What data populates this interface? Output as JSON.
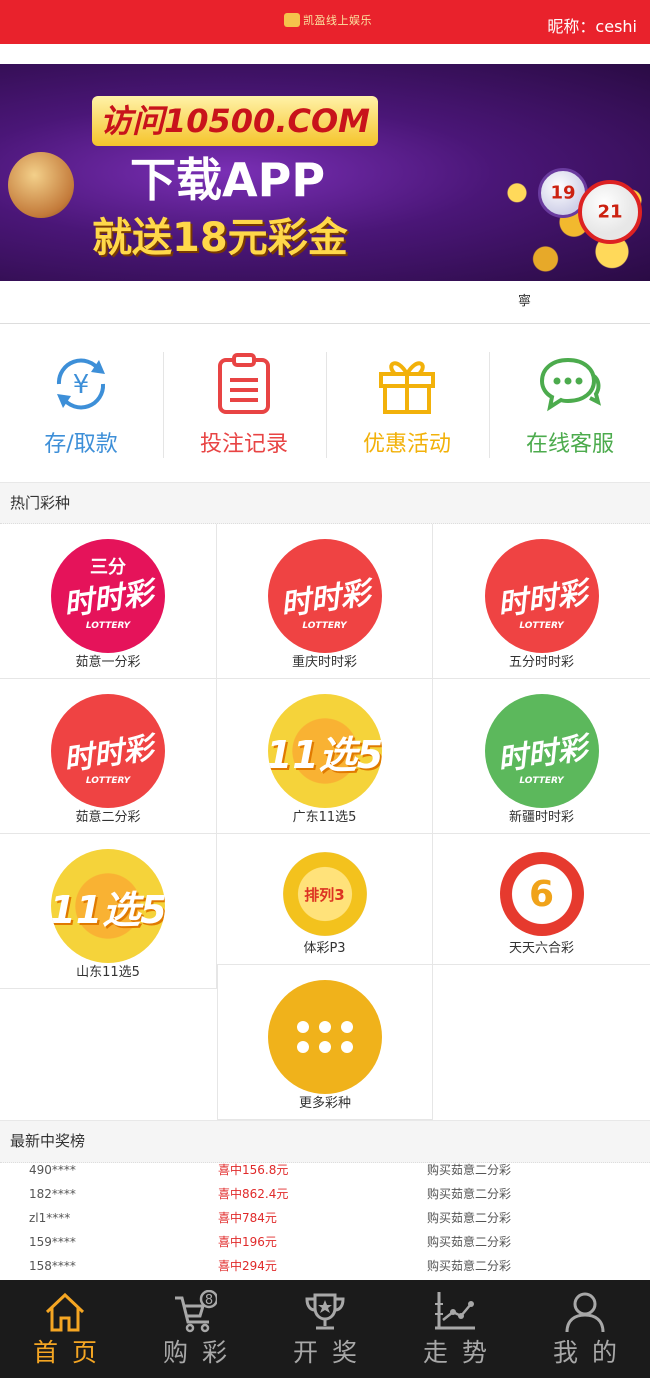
{
  "header": {
    "logo_text": "凯盈线上娱乐",
    "nickname": "昵称：ceshi",
    "bg_color": "#e9222c"
  },
  "banner": {
    "visit": "访问10500.COM",
    "line2": "下载APP",
    "line3": "就送18元彩金",
    "ball_a": "19",
    "ball_b": "21"
  },
  "notice": {
    "text": "寧"
  },
  "quick_actions": [
    {
      "label": "存/取款",
      "icon": "yen-exchange-icon",
      "color": "#3d8fd8"
    },
    {
      "label": "投注记录",
      "icon": "clipboard-icon",
      "color": "#e84444"
    },
    {
      "label": "优惠活动",
      "icon": "gift-icon",
      "color": "#f2b10a"
    },
    {
      "label": "在线客服",
      "icon": "chat-icon",
      "color": "#4cab4d"
    }
  ],
  "hot_section": {
    "title": "热门彩种"
  },
  "lotteries": [
    {
      "name": "茹意一分彩",
      "icon": "ssc-1min-icon",
      "top": "三分",
      "main": "时时彩",
      "sub": "LOTTERY",
      "color": "#e5135a"
    },
    {
      "name": "重庆时时彩",
      "icon": "ssc-icon",
      "main": "时时彩",
      "sub": "LOTTERY",
      "color": "#ef4343"
    },
    {
      "name": "五分时时彩",
      "icon": "ssc-icon",
      "main": "时时彩",
      "sub": "LOTTERY",
      "color": "#ef4343"
    },
    {
      "name": "茹意二分彩",
      "icon": "ssc-icon",
      "main": "时时彩",
      "sub": "LOTTERY",
      "color": "#ef4343"
    },
    {
      "name": "广东11选5",
      "icon": "11x5-icon",
      "main": "11选5",
      "color": "#f5d33a"
    },
    {
      "name": "新疆时时彩",
      "icon": "ssc-icon",
      "main": "时时彩",
      "sub": "LOTTERY",
      "color": "#5cb85c"
    },
    {
      "name": "山东11选5",
      "icon": "11x5-icon",
      "main": "11选5",
      "color": "#f5d33a"
    },
    {
      "name": "体彩P3",
      "icon": "p3-icon",
      "main": "排列3"
    },
    {
      "name": "天天六合彩",
      "icon": "liuhecai-icon",
      "main": "6"
    },
    {
      "name": "更多彩种",
      "icon": "more-dots-icon",
      "color": "#f0b21b"
    }
  ],
  "winners_section": {
    "title": "最新中奖榜"
  },
  "winners": [
    {
      "user": "490****",
      "amount": "喜中156.8元",
      "game": "购买茹意二分彩"
    },
    {
      "user": "182****",
      "amount": "喜中862.4元",
      "game": "购买茹意二分彩"
    },
    {
      "user": "zl1****",
      "amount": "喜中784元",
      "game": "购买茹意二分彩"
    },
    {
      "user": "159****",
      "amount": "喜中196元",
      "game": "购买茹意二分彩"
    },
    {
      "user": "158****",
      "amount": "喜中294元",
      "game": "购买茹意二分彩"
    }
  ],
  "tabbar": [
    {
      "label": "首页",
      "icon": "home-icon",
      "active": true
    },
    {
      "label": "购彩",
      "icon": "cart-icon",
      "badge": "8"
    },
    {
      "label": "开奖",
      "icon": "trophy-icon"
    },
    {
      "label": "走势",
      "icon": "trend-chart-icon"
    },
    {
      "label": "我的",
      "icon": "user-icon"
    }
  ],
  "colors": {
    "accent": "#f5a623",
    "tab_bg": "#1b1b1b",
    "win_amount": "#e02a2a"
  }
}
